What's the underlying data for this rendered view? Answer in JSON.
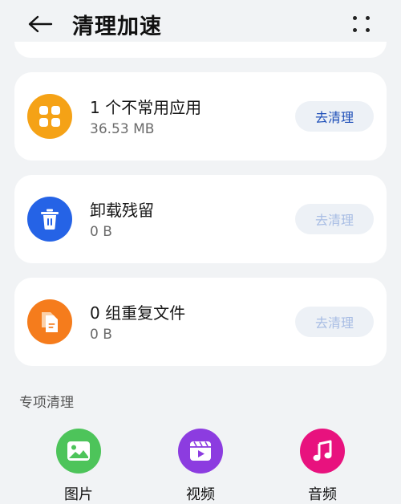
{
  "header": {
    "title": "清理加速",
    "back_icon": "arrow-left-icon",
    "more_icon": "more-dots-icon"
  },
  "cards": [
    {
      "title": "1 个不常用应用",
      "subtitle": "36.53 MB",
      "button": "去清理",
      "button_enabled": true,
      "icon": "apps-grid-icon",
      "icon_color": "#f5a216"
    },
    {
      "title": "卸载残留",
      "subtitle": "0 B",
      "button": "去清理",
      "button_enabled": false,
      "icon": "trash-icon",
      "icon_color": "#2563e6"
    },
    {
      "title": "0 组重复文件",
      "subtitle": "0 B",
      "button": "去清理",
      "button_enabled": false,
      "icon": "duplicate-file-icon",
      "icon_color": "#f57c1c"
    }
  ],
  "special": {
    "title": "专项清理",
    "items": [
      {
        "label": "图片",
        "icon": "image-icon",
        "color": "#4dc45a"
      },
      {
        "label": "视频",
        "icon": "video-icon",
        "color": "#8c3ce0"
      },
      {
        "label": "音频",
        "icon": "music-icon",
        "color": "#e8127e"
      }
    ]
  },
  "colors": {
    "background": "#f1f3f5",
    "card": "#ffffff",
    "button_bg": "#edf1f6",
    "button_text": "#1e4fb8",
    "button_text_disabled": "#a8bde4"
  }
}
